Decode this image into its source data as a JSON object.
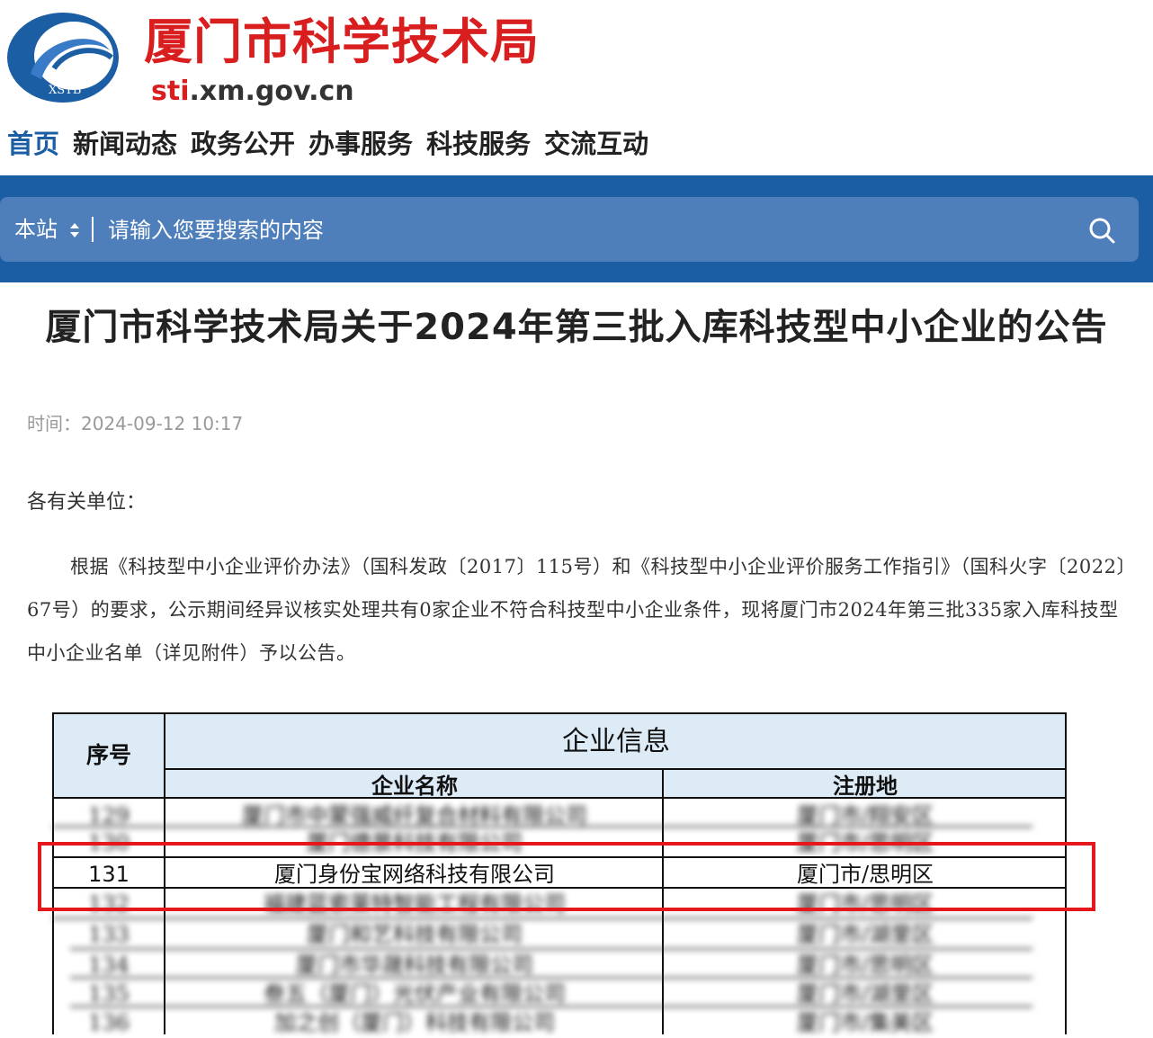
{
  "header": {
    "logo_text": "XSTB",
    "site_title": "厦门市科学技术局",
    "domain_prefix": "sti",
    "domain_suffix": ".xm.gov.cn"
  },
  "nav": {
    "items": [
      "首页",
      "新闻动态",
      "政务公开",
      "办事服务",
      "科技服务",
      "交流互动"
    ],
    "active_index": 0
  },
  "search": {
    "scope_label": "本站",
    "placeholder": "请输入您要搜索的内容"
  },
  "article": {
    "title": "厦门市科学技术局关于2024年第三批入库科技型中小企业的公告",
    "time_label": "时间：",
    "time_value": "2024-09-12 10:17",
    "salutation": "各有关单位：",
    "body": "根据《科技型中小企业评价办法》（国科发政〔2017〕115号）和《科技型中小企业评价服务工作指引》（国科火字〔2022〕67号）的要求，公示期间经异议核实处理共有0家企业不符合科技型中小企业条件，现将厦门市2024年第三批335家入库科技型中小企业名单（详见附件）予以公告。"
  },
  "table": {
    "header_seq": "序号",
    "header_group": "企业信息",
    "header_name": "企业名称",
    "header_location": "注册地",
    "highlight_row": {
      "seq": "131",
      "name": "厦门身份宝网络科技有限公司",
      "location": "厦门市/思明区"
    },
    "blurred_rows": [
      {
        "seq": "129",
        "name": "厦门市中蒙强威纤复合材料有限公司",
        "location": "厦门市/翔安区"
      },
      {
        "seq": "130",
        "name": "厦门德景科技有限公司",
        "location": "厦门市/思明区"
      },
      {
        "seq": "132",
        "name": "福建蓝索莱特智能工程有限公司",
        "location": "厦门市/思明区"
      },
      {
        "seq": "133",
        "name": "厦门和艺科技有限公司",
        "location": "厦门市/湖里区"
      },
      {
        "seq": "134",
        "name": "厦门市华晟科技有限公司",
        "location": "厦门市/思明区"
      },
      {
        "seq": "135",
        "name": "叁五（厦门）光伏产业有限公司",
        "location": "厦门市/湖里区"
      },
      {
        "seq": "136",
        "name": "加之创（厦门）科技有限公司",
        "location": "厦门市/集美区"
      }
    ]
  },
  "colors": {
    "brand_red": "#d81e1e",
    "brand_blue": "#1b5ea4",
    "search_box": "#4e7fbb",
    "highlight_border": "#e3171c",
    "table_header_bg": "#ddebf7"
  }
}
